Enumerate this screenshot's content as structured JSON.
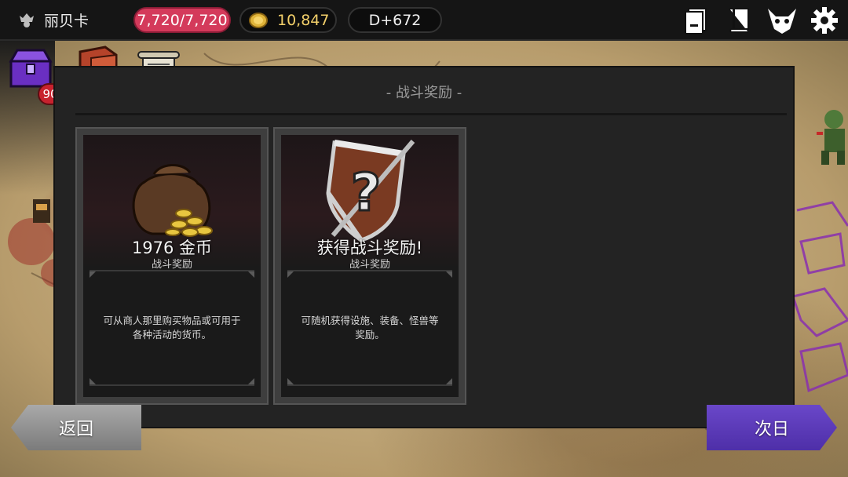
{
  "player": {
    "name": "丽贝卡",
    "icon": "crown-skull-icon"
  },
  "stats": {
    "hp": "7,720/7,720",
    "gold": "10,847",
    "day": "D+672"
  },
  "top_icons": [
    "cards-icon",
    "spellbook-icon",
    "demon-skull-icon",
    "gear-icon"
  ],
  "shortcuts": {
    "chest_badge": "90"
  },
  "panel": {
    "title": "- 战斗奖励 -",
    "cards": [
      {
        "title": "1976 金币",
        "subtitle": "战斗奖励",
        "description": "可从商人那里购买物品或可用于各种活动的货币。",
        "icon": "gold-sack-icon"
      },
      {
        "title": "获得战斗奖励!",
        "subtitle": "战斗奖励",
        "description": "可随机获得设施、装备、怪兽等奖励。",
        "icon": "mystery-shield-icon"
      }
    ]
  },
  "buttons": {
    "back": "返回",
    "next": "次日"
  },
  "colors": {
    "hp_pill": "#d43a5b",
    "gold_text": "#f2cf6a",
    "next_button": "#5b3bb8",
    "back_button": "#8f8f8f"
  }
}
